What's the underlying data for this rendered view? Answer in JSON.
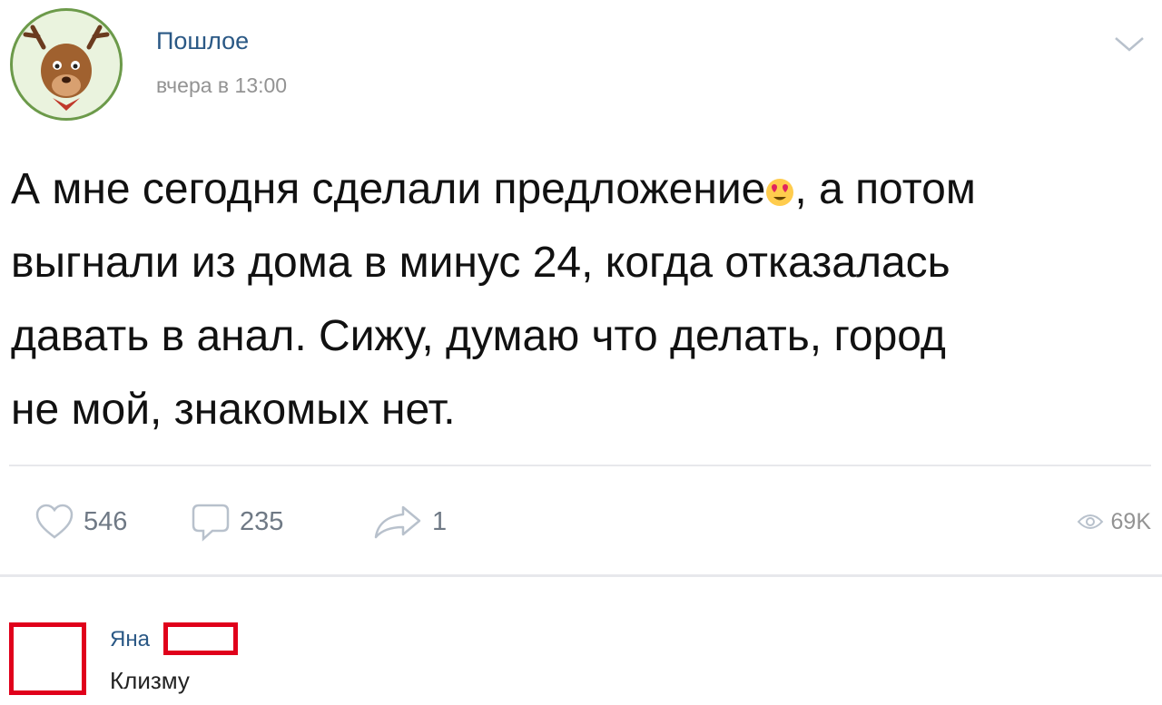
{
  "post": {
    "author": "Пошлое",
    "time": "вчера в 13:00",
    "text_line1_before_emoji": "А мне сегодня сделали предложение",
    "emoji": "heart-eyes-emoji",
    "text_line1_after_emoji": ", а потом",
    "text_line2": "выгнали из дома в минус 24, когда отказалась",
    "text_line3": "давать в анал. Сижу, думаю что делать, город",
    "text_line4": "не мой, знакомых нет."
  },
  "actions": {
    "likes": "546",
    "comments": "235",
    "shares": "1",
    "views": "69K"
  },
  "comment": {
    "author": "Яна",
    "text": "Клизму"
  },
  "colors": {
    "link": "#2a5885",
    "muted": "#939393",
    "action_icon": "#b8c1cc",
    "redaction": "#e0001b",
    "avatar_ring": "#6c9a4a"
  }
}
